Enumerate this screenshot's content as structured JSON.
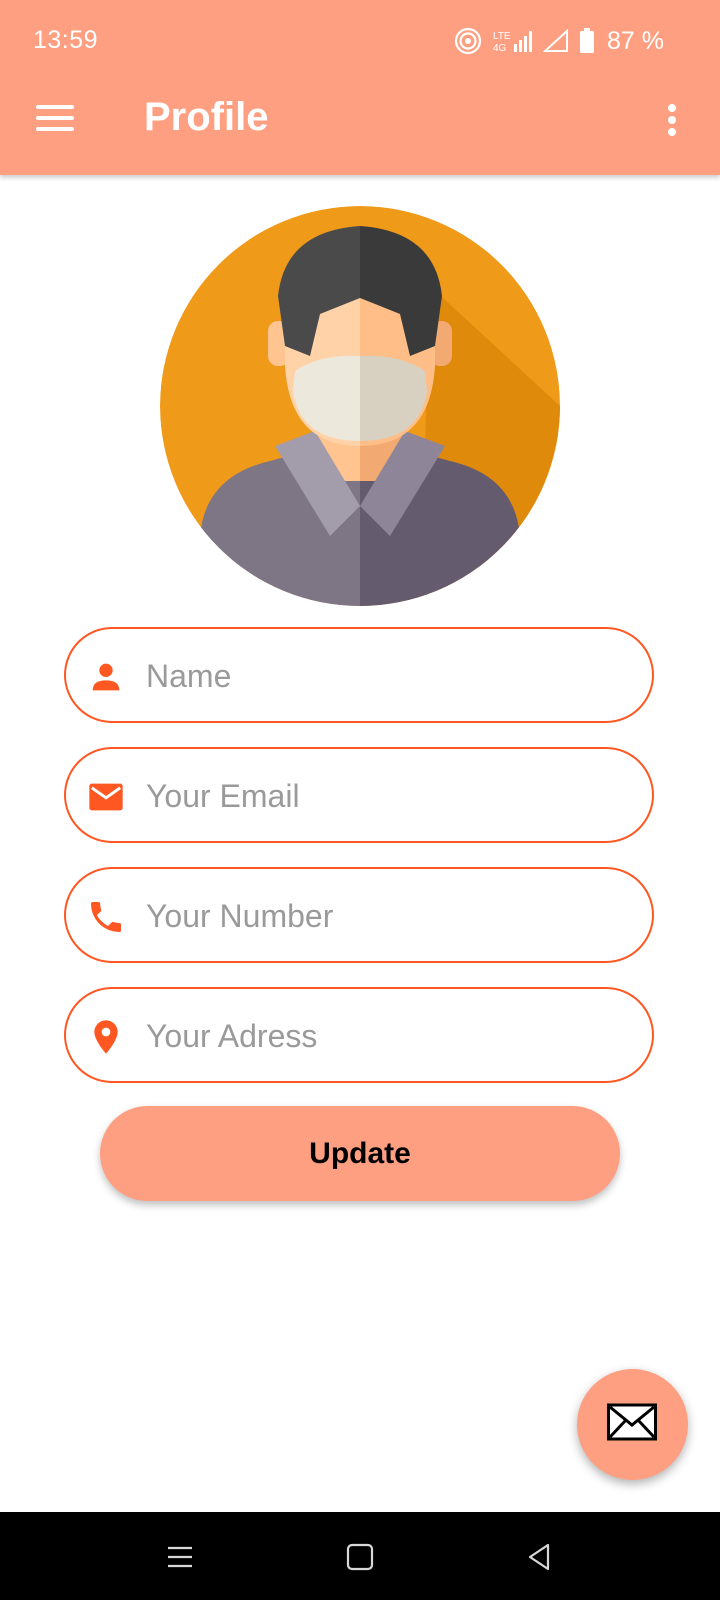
{
  "status_bar": {
    "time": "13:59",
    "battery": "87 %",
    "icons": [
      "hotspot-icon",
      "lte-signal-icon",
      "signal-icon",
      "battery-icon"
    ]
  },
  "app_bar": {
    "title": "Profile",
    "menu_icon": "menu-icon",
    "more_icon": "more-vert-icon"
  },
  "profile": {
    "avatar_icon": "masked-man-avatar"
  },
  "form": {
    "fields": [
      {
        "icon": "person-icon",
        "placeholder": "Name",
        "value": ""
      },
      {
        "icon": "email-icon",
        "placeholder": "Your Email",
        "value": ""
      },
      {
        "icon": "phone-icon",
        "placeholder": "Your Number",
        "value": ""
      },
      {
        "icon": "location-icon",
        "placeholder": "Your Adress",
        "value": ""
      }
    ],
    "submit_label": "Update"
  },
  "fab": {
    "icon": "mail-icon"
  },
  "colors": {
    "primary": "#FF9F82",
    "accent": "#FF5722",
    "placeholder": "#9A9A9A"
  },
  "nav_bar": {
    "icons": [
      "recents-icon",
      "home-icon",
      "back-icon"
    ]
  }
}
